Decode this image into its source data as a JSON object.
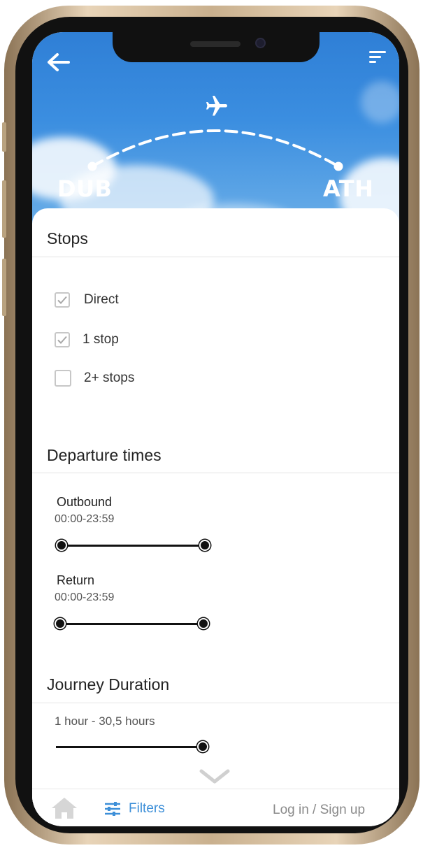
{
  "header": {
    "origin": "DUB",
    "destination": "ATH",
    "icons": [
      "back-arrow-icon",
      "sort-icon",
      "airplane-icon"
    ]
  },
  "stops": {
    "title": "Stops",
    "options": [
      {
        "label": "Direct",
        "checked": true
      },
      {
        "label": "1 stop",
        "checked": true
      },
      {
        "label": "2+ stops",
        "checked": false
      }
    ]
  },
  "departure": {
    "title": "Departure times",
    "outbound": {
      "label": "Outbound",
      "range": "00:00-23:59",
      "min": 0,
      "max": 1
    },
    "return": {
      "label": "Return",
      "range": "00:00-23:59",
      "min": 0,
      "max": 1
    }
  },
  "duration": {
    "title": "Journey Duration",
    "range": "1 hour - 30,5 hours",
    "value": 1
  },
  "tabbar": {
    "home_icon": "home-icon",
    "filters_label": "Filters",
    "filters_icon": "sliders-icon",
    "login_label": "Log in / Sign up"
  },
  "colors": {
    "accent": "#3d8fd8",
    "sky": "#2f7fd6",
    "frame": "#c9b08e"
  }
}
